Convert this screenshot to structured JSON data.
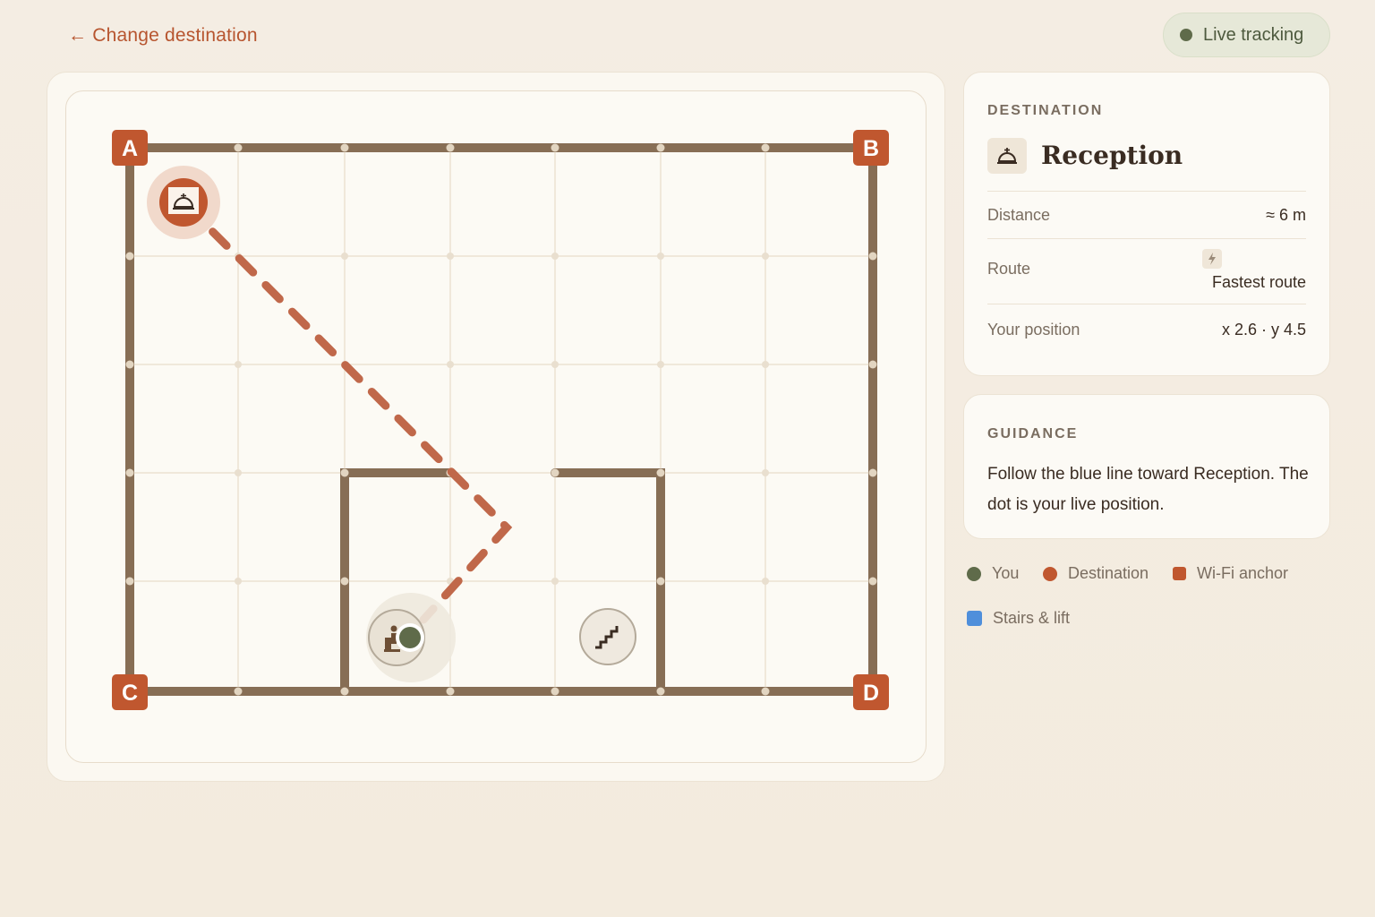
{
  "header": {
    "back_label": "← Change destination",
    "live_label": "Live tracking"
  },
  "map": {
    "anchors": [
      "A",
      "B",
      "C",
      "D"
    ],
    "destination_icon": "service-bell-icon",
    "you_icon": "elevator-person-icon",
    "stairs_icon": "stairs-icon"
  },
  "destination": {
    "section_label": "DESTINATION",
    "name": "Reception",
    "icon": "service-bell-icon",
    "distance_label": "Distance",
    "distance_value": "≈ 6 m",
    "route_label": "Route",
    "route_value": "Fastest route",
    "route_icon": "lightning-icon",
    "position_label": "Your position",
    "position_value": "x 2.6 · y 4.5"
  },
  "guidance": {
    "section_label": "GUIDANCE",
    "text": "Follow the blue line toward Reception. The dot is your live position."
  },
  "legend": {
    "you": "You",
    "destination": "Destination",
    "wifi": "Wi-Fi anchor",
    "stairs": "Stairs & lift"
  },
  "colors": {
    "accent": "#c0572f",
    "you": "#5f6b4a",
    "wall": "#876e55",
    "stairs": "#4f8fdb"
  }
}
